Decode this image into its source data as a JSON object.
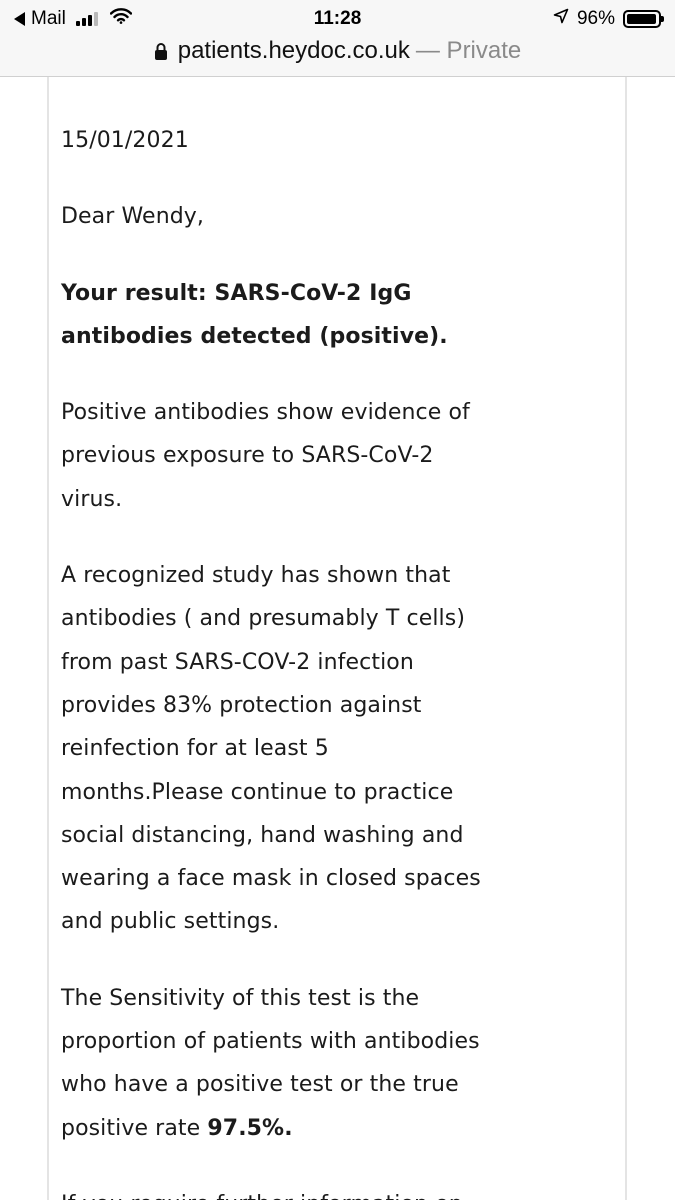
{
  "status_bar": {
    "back_app": "Mail",
    "time": "11:28",
    "battery": "96%",
    "battery_level": 0.96
  },
  "browser": {
    "domain": "patients.heydoc.co.uk",
    "privacy": "— Private"
  },
  "letter": {
    "date": "15/01/2021",
    "greeting": "Dear Wendy,",
    "result_line1": "Your result: SARS-CoV-2 IgG",
    "result_line2": "antibodies detected (positive).",
    "para1": [
      "Positive antibodies show evidence of",
      "previous exposure to SARS-CoV-2",
      "virus."
    ],
    "para2": [
      "A recognized study has shown that",
      "antibodies ( and presumably T cells)",
      "from past SARS-COV-2 infection",
      "provides 83% protection against",
      "reinfection for at least 5",
      "months.Please continue to practice",
      "social distancing, hand washing and",
      "wearing a face mask in closed spaces",
      "and public settings."
    ],
    "para3": [
      "The Sensitivity of this test is the",
      "proportion of patients with antibodies",
      "who have a positive test or the true"
    ],
    "para3_last_prefix": "positive rate ",
    "para3_last_bold": "97.5%.",
    "para4": [
      "If you require further information on"
    ]
  }
}
